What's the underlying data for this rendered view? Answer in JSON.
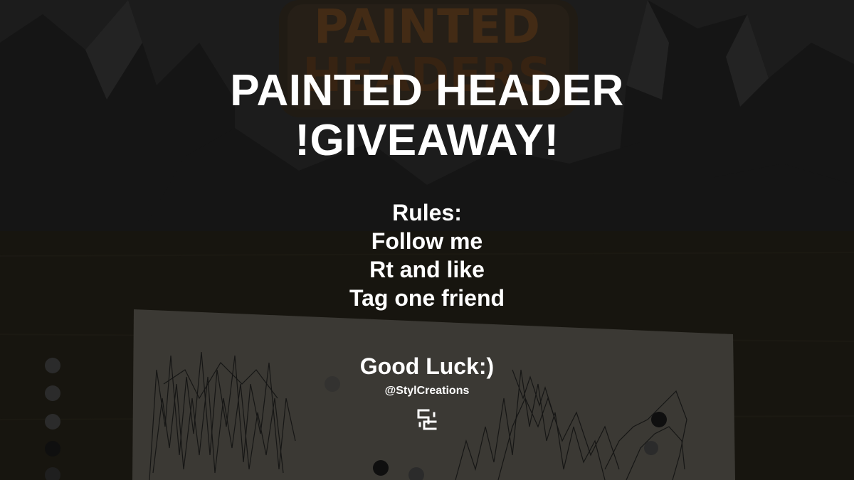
{
  "background": {
    "sign_text": [
      "PAINTED",
      "HEADERS"
    ],
    "sign_color": "#c8782e",
    "sky_color": "#2a2a2a",
    "table_color": "#201d14",
    "paper_color": "#5c5a52"
  },
  "title": {
    "line1": "PAINTED HEADER",
    "line2": "!GIVEAWAY!"
  },
  "rules": {
    "heading": "Rules:",
    "items": [
      "Follow me",
      "Rt and like",
      "Tag one friend"
    ]
  },
  "closing": "Good Luck:)",
  "handle": "@StylCreations",
  "logo_icon": "sc-monogram-icon"
}
